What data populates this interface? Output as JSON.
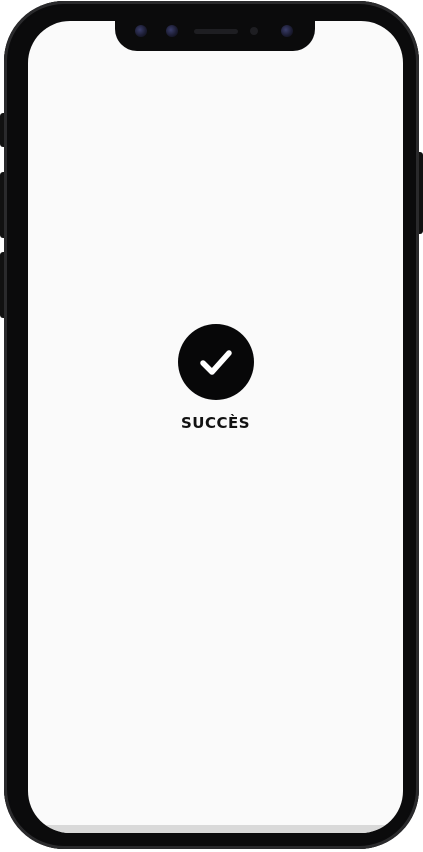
{
  "device": {
    "frame_color": "#0b0b0c",
    "screen_color": "#fafafa"
  },
  "status": {
    "icon": "checkmark-icon",
    "label": "SUCCÈS",
    "badge_color": "#070708"
  }
}
